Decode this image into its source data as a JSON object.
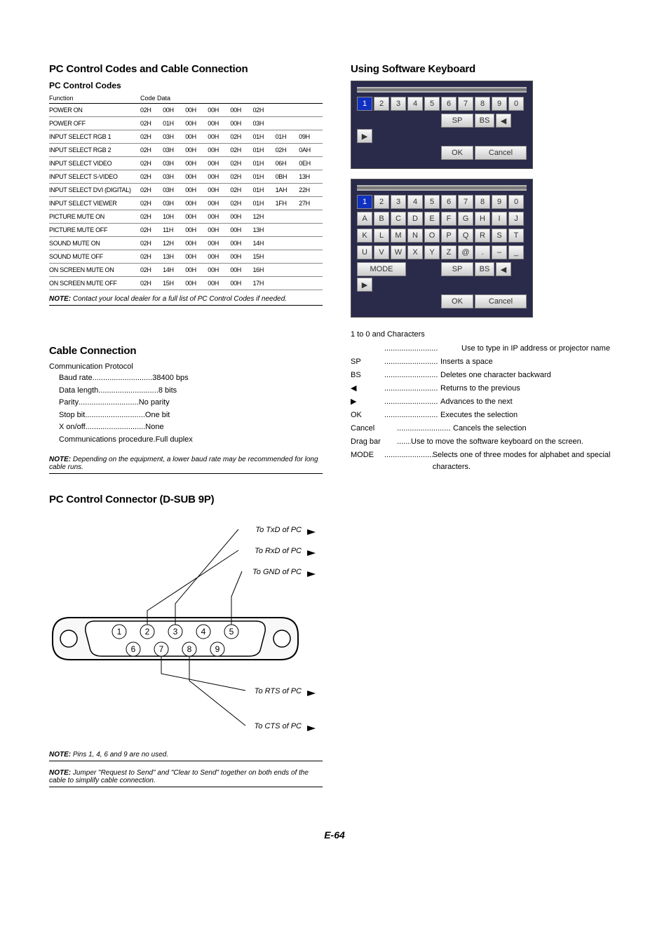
{
  "left": {
    "h_codes": "PC Control Codes and Cable Connection",
    "h_codes_sub": "PC Control Codes",
    "table_headers": [
      "Function",
      "Code Data"
    ],
    "codes": [
      {
        "fn": "POWER ON",
        "d": [
          "02H",
          "00H",
          "00H",
          "00H",
          "00H",
          "02H",
          "",
          ""
        ]
      },
      {
        "fn": "POWER OFF",
        "d": [
          "02H",
          "01H",
          "00H",
          "00H",
          "00H",
          "03H",
          "",
          ""
        ]
      },
      {
        "fn": "INPUT SELECT RGB 1",
        "d": [
          "02H",
          "03H",
          "00H",
          "00H",
          "02H",
          "01H",
          "01H",
          "09H"
        ]
      },
      {
        "fn": "INPUT SELECT RGB 2",
        "d": [
          "02H",
          "03H",
          "00H",
          "00H",
          "02H",
          "01H",
          "02H",
          "0AH"
        ]
      },
      {
        "fn": "INPUT SELECT VIDEO",
        "d": [
          "02H",
          "03H",
          "00H",
          "00H",
          "02H",
          "01H",
          "06H",
          "0EH"
        ]
      },
      {
        "fn": "INPUT SELECT S-VIDEO",
        "d": [
          "02H",
          "03H",
          "00H",
          "00H",
          "02H",
          "01H",
          "0BH",
          "13H"
        ]
      },
      {
        "fn": "INPUT SELECT DVI (DIGITAL)",
        "d": [
          "02H",
          "03H",
          "00H",
          "00H",
          "02H",
          "01H",
          "1AH",
          "22H"
        ]
      },
      {
        "fn": "INPUT SELECT VIEWER",
        "d": [
          "02H",
          "03H",
          "00H",
          "00H",
          "02H",
          "01H",
          "1FH",
          "27H"
        ]
      },
      {
        "fn": "PICTURE MUTE ON",
        "d": [
          "02H",
          "10H",
          "00H",
          "00H",
          "00H",
          "12H",
          "",
          ""
        ]
      },
      {
        "fn": "PICTURE MUTE OFF",
        "d": [
          "02H",
          "11H",
          "00H",
          "00H",
          "00H",
          "13H",
          "",
          ""
        ]
      },
      {
        "fn": "SOUND MUTE ON",
        "d": [
          "02H",
          "12H",
          "00H",
          "00H",
          "00H",
          "14H",
          "",
          ""
        ]
      },
      {
        "fn": "SOUND MUTE OFF",
        "d": [
          "02H",
          "13H",
          "00H",
          "00H",
          "00H",
          "15H",
          "",
          ""
        ]
      },
      {
        "fn": "ON SCREEN MUTE ON",
        "d": [
          "02H",
          "14H",
          "00H",
          "00H",
          "00H",
          "16H",
          "",
          ""
        ]
      },
      {
        "fn": "ON SCREEN MUTE OFF",
        "d": [
          "02H",
          "15H",
          "00H",
          "00H",
          "00H",
          "17H",
          "",
          ""
        ]
      }
    ],
    "note_codes": "Contact your local dealer for a full list of PC Control Codes if needed.",
    "h_cable": "Cable Connection",
    "cable_sub": "Communication Protocol",
    "specs": [
      {
        "l": "Baud rate",
        "v": "38400 bps"
      },
      {
        "l": "Data length",
        "v": "8 bits"
      },
      {
        "l": "Parity",
        "v": "No parity"
      },
      {
        "l": "Stop bit",
        "v": "One bit"
      },
      {
        "l": "X on/off",
        "v": "None"
      },
      {
        "l": "Communications procedure",
        "v": "Full duplex"
      }
    ],
    "note_baud": "Depending on the equipment, a lower baud rate may be recommended for long cable runs.",
    "h_connector": "PC Control Connector (D-SUB 9P)",
    "diag_labels": {
      "txd": "To TxD of PC",
      "rxd": "To RxD of PC",
      "gnd": "To GND of PC",
      "rts": "To RTS of PC",
      "cts": "To CTS of PC"
    },
    "note_pins": "Pins 1, 4, 6 and 9 are no used.",
    "note_jumper": "Jumper \"Request to Send\" and \"Clear to Send\" together on both ends of the cable to simplify cable connection."
  },
  "right": {
    "h_kb": "Using Software Keyboard",
    "kb_numeric": {
      "row1": [
        "1",
        "2",
        "3",
        "4",
        "5",
        "6",
        "7",
        "8",
        "9",
        "0"
      ],
      "row2_sp": "SP",
      "row2_bs": "BS",
      "row2_l": "◀",
      "row2_r": "▶",
      "row3_ok": "OK",
      "row3_cancel": "Cancel"
    },
    "kb_alpha": {
      "row1": [
        "1",
        "2",
        "3",
        "4",
        "5",
        "6",
        "7",
        "8",
        "9",
        "0"
      ],
      "row2": [
        "A",
        "B",
        "C",
        "D",
        "E",
        "F",
        "G",
        "H",
        "I",
        "J"
      ],
      "row3": [
        "K",
        "L",
        "M",
        "N",
        "O",
        "P",
        "Q",
        "R",
        "S",
        "T"
      ],
      "row4": [
        "U",
        "V",
        "W",
        "X",
        "Y",
        "Z",
        "@",
        ".",
        "–",
        "_"
      ],
      "row5_mode": "MODE",
      "row5_sp": "SP",
      "row5_bs": "BS",
      "row5_l": "◀",
      "row5_r": "▶",
      "row6_ok": "OK",
      "row6_cancel": "Cancel"
    },
    "glossary_title": "1 to 0 and Characters",
    "glossary": [
      {
        "t": "",
        "d": "Use to type in IP address or projector name"
      },
      {
        "t": "SP",
        "d": "Inserts a space"
      },
      {
        "t": "BS",
        "d": "Deletes one character backward"
      },
      {
        "t": "◀",
        "d": "Returns to the previous"
      },
      {
        "t": "▶",
        "d": "Advances to the next"
      },
      {
        "t": "OK",
        "d": "Executes the selection"
      },
      {
        "t": "Cancel",
        "d": "Cancels the selection"
      },
      {
        "t": "Drag bar",
        "d": "Use to move the software keyboard on the screen."
      },
      {
        "t": "MODE",
        "d": "Selects one of three modes for alphabet and special characters."
      }
    ]
  },
  "footer": "E-64",
  "note_label": "NOTE:"
}
